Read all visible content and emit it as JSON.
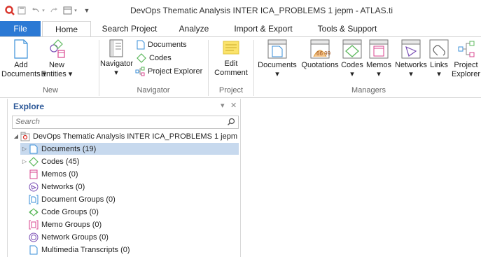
{
  "window": {
    "title": "DevOps Thematic Analysis INTER ICA_PROBLEMS 1 jepm - ATLAS.ti"
  },
  "tabs": [
    "File",
    "Home",
    "Search Project",
    "Analyze",
    "Import & Export",
    "Tools & Support"
  ],
  "ribbon": {
    "new_group": {
      "add_documents_line1": "Add",
      "add_documents_line2": "Documents ▾",
      "new_entities_line1": "New",
      "new_entities_line2": "Entities ▾",
      "label": "New"
    },
    "navigator_group": {
      "navigator": "Navigator",
      "navigator_arrow": "▾",
      "documents": "Documents",
      "codes": "Codes",
      "project_explorer": "Project Explorer",
      "label": "Navigator"
    },
    "project_group": {
      "edit_line1": "Edit",
      "edit_line2": "Comment",
      "label": "Project"
    },
    "managers_group": {
      "documents": "Documents",
      "quotations": "Quotations",
      "codes": "Codes",
      "memos": "Memos",
      "networks": "Networks",
      "links": "Links",
      "project_line1": "Project",
      "project_line2": "Explorer",
      "arrow": "▾",
      "label": "Managers"
    }
  },
  "explore": {
    "title": "Explore",
    "pin": "▾",
    "close": "✕",
    "search_placeholder": "Search",
    "root": "DevOps Thematic Analysis INTER ICA_PROBLEMS 1 jepm",
    "items": [
      {
        "label": "Documents (19)",
        "icon": "document-icon",
        "expandable": true,
        "selected": true
      },
      {
        "label": "Codes (45)",
        "icon": "code-icon",
        "expandable": true,
        "selected": false
      },
      {
        "label": "Memos (0)",
        "icon": "memo-icon",
        "expandable": false,
        "selected": false
      },
      {
        "label": "Networks (0)",
        "icon": "network-icon",
        "expandable": false,
        "selected": false
      },
      {
        "label": "Document Groups (0)",
        "icon": "document-group-icon",
        "expandable": false,
        "selected": false
      },
      {
        "label": "Code Groups (0)",
        "icon": "code-group-icon",
        "expandable": false,
        "selected": false
      },
      {
        "label": "Memo Groups (0)",
        "icon": "memo-group-icon",
        "expandable": false,
        "selected": false
      },
      {
        "label": "Network Groups (0)",
        "icon": "network-group-icon",
        "expandable": false,
        "selected": false
      },
      {
        "label": "Multimedia Transcripts (0)",
        "icon": "transcript-icon",
        "expandable": false,
        "selected": false
      }
    ]
  },
  "colors": {
    "file_tab": "#2b79d4",
    "selection": "#c7d9ee",
    "accent_blue": "#3a8fd8",
    "code_green": "#5cb85c",
    "memo_pink": "#d9468f",
    "network_purple": "#7a4fb5",
    "logo_red": "#d9342b"
  }
}
